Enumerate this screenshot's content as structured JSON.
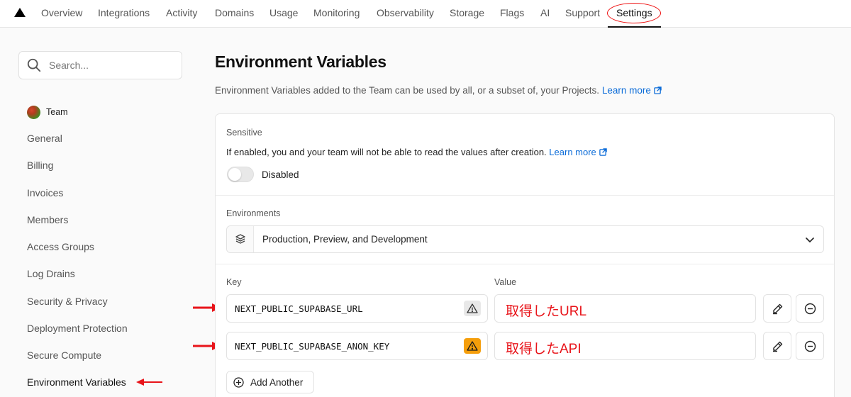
{
  "nav": {
    "tabs": [
      {
        "label": "Overview"
      },
      {
        "label": "Integrations"
      },
      {
        "label": "Activity"
      },
      {
        "label": "Domains"
      },
      {
        "label": "Usage"
      },
      {
        "label": "Monitoring"
      },
      {
        "label": "Observability"
      },
      {
        "label": "Storage"
      },
      {
        "label": "Flags"
      },
      {
        "label": "AI"
      },
      {
        "label": "Support"
      },
      {
        "label": "Settings"
      }
    ],
    "active_tab": "Settings",
    "annotation_color": "#e11111"
  },
  "sidebar": {
    "search_placeholder": "Search...",
    "team_label": "Team",
    "items": [
      {
        "label": "General"
      },
      {
        "label": "Billing"
      },
      {
        "label": "Invoices"
      },
      {
        "label": "Members"
      },
      {
        "label": "Access Groups"
      },
      {
        "label": "Log Drains"
      },
      {
        "label": "Security & Privacy"
      },
      {
        "label": "Deployment Protection"
      },
      {
        "label": "Secure Compute"
      },
      {
        "label": "Environment Variables"
      }
    ],
    "active_item": "Environment Variables"
  },
  "main": {
    "title": "Environment Variables",
    "description": "Environment Variables added to the Team can be used by all, or a subset of, your Projects.",
    "learn_more": "Learn more",
    "sensitive": {
      "label": "Sensitive",
      "description": "If enabled, you and your team will not be able to read the values after creation.",
      "learn_more": "Learn more",
      "toggle_state": "Disabled"
    },
    "environments": {
      "label": "Environments",
      "selected": "Production, Preview, and Development"
    },
    "key_header": "Key",
    "value_header": "Value",
    "rows": [
      {
        "key": "NEXT_PUBLIC_SUPABASE_URL",
        "value": "取得したURL",
        "warning": "neutral"
      },
      {
        "key": "NEXT_PUBLIC_SUPABASE_ANON_KEY",
        "value": "取得したAPI",
        "warning": "orange"
      }
    ],
    "add_another": "Add Another"
  },
  "colors": {
    "link": "#0a6bd8",
    "annotation_red": "#e8141a",
    "warning_orange": "#f59e0b"
  }
}
